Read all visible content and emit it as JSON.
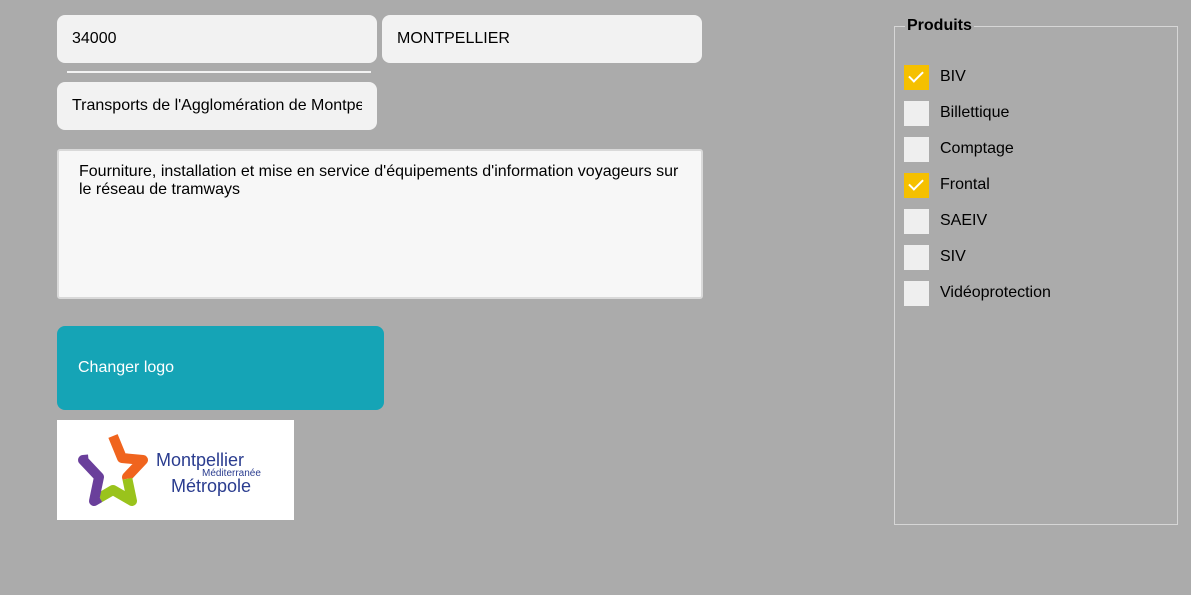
{
  "form": {
    "postal_code": "34000",
    "city": "MONTPELLIER",
    "organization": "Transports de l'Agglomération de Montpelli",
    "description": "Fourniture, installation et mise en service d'équipements d'information voyageurs sur le réseau de tramways"
  },
  "logo_button": {
    "label": "Changer logo"
  },
  "logo": {
    "line1": "Montpellier",
    "line2": "Méditerranée",
    "line3": "Métropole",
    "colors": {
      "orange": "#f0641e",
      "green": "#9ac31c",
      "purple": "#6a3f9b",
      "navy": "#2a3c8f"
    }
  },
  "products": {
    "legend": "Produits",
    "items": [
      {
        "label": "BIV",
        "checked": true
      },
      {
        "label": "Billettique",
        "checked": false
      },
      {
        "label": "Comptage",
        "checked": false
      },
      {
        "label": "Frontal",
        "checked": true
      },
      {
        "label": "SAEIV",
        "checked": false
      },
      {
        "label": "SIV",
        "checked": false
      },
      {
        "label": "Vidéoprotection",
        "checked": false
      }
    ]
  },
  "colors": {
    "background": "#ababab",
    "accent": "#15a4b6",
    "check": "#f5c000"
  }
}
